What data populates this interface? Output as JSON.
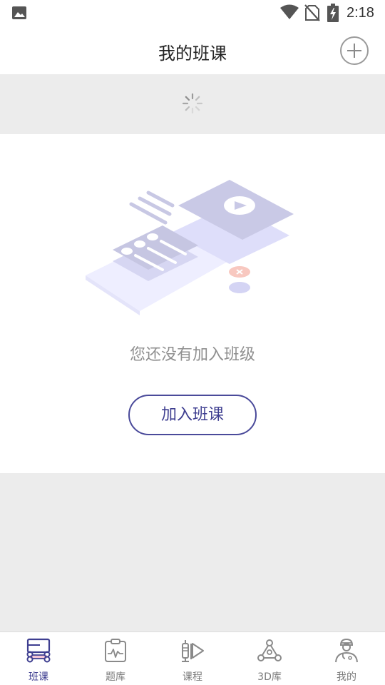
{
  "status_bar": {
    "time": "2:18",
    "icons": [
      "gallery-icon",
      "wifi-icon",
      "no-sim-icon",
      "battery-charging-icon"
    ]
  },
  "header": {
    "title": "我的班课",
    "add_icon": "plus-circle-icon"
  },
  "loading": {
    "icon": "spinner-icon"
  },
  "empty_state": {
    "illustration": "empty-course-illustration",
    "message": "您还没有加入班级",
    "join_button_label": "加入班课"
  },
  "bottom_nav": {
    "items": [
      {
        "label": "班课",
        "icon": "class-icon",
        "active": true
      },
      {
        "label": "题库",
        "icon": "question-bank-icon",
        "active": false
      },
      {
        "label": "课程",
        "icon": "course-icon",
        "active": false
      },
      {
        "label": "3D库",
        "icon": "molecule-3d-icon",
        "active": false
      },
      {
        "label": "我的",
        "icon": "doctor-profile-icon",
        "active": false
      }
    ]
  },
  "colors": {
    "accent": "#3e3e90",
    "background": "#ececec",
    "surface": "#ffffff",
    "muted_text": "#8f8f8f"
  }
}
